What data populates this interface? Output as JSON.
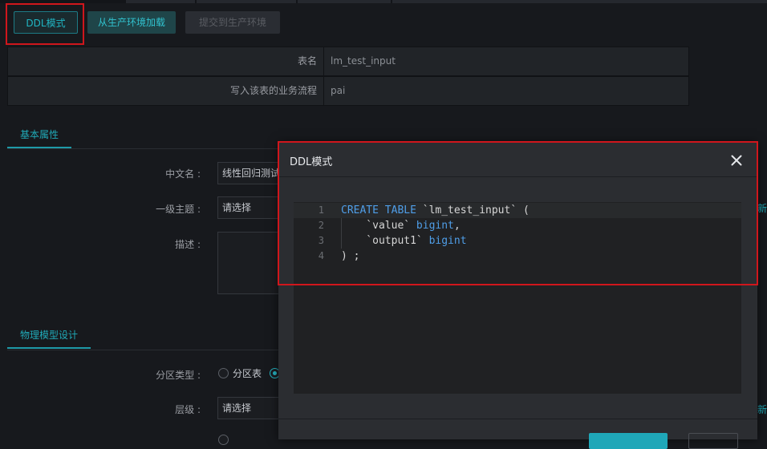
{
  "toolbar": {
    "ddl_mode": "DDL模式",
    "load_from_prod": "从生产环境加载",
    "submit_to_prod": "提交到生产环境"
  },
  "table_info": {
    "rows": [
      {
        "label": "表名",
        "value": "lm_test_input"
      },
      {
        "label": "写入该表的业务流程",
        "value": "pai"
      }
    ]
  },
  "sections": {
    "basic": "基本属性",
    "physical": "物理模型设计"
  },
  "basic_form": {
    "chinese_name_label": "中文名",
    "chinese_name_value": "线性回归测试",
    "level1_topic_label": "一级主题",
    "level1_topic_value": "请选择",
    "description_label": "描述"
  },
  "physical_form": {
    "partition_type_label": "分区类型",
    "partition_table_option": "分区表",
    "level_label": "层级",
    "level_value": "请选择"
  },
  "edge": {
    "new_topic_link": "新建"
  },
  "modal": {
    "title": "DDL模式",
    "close_icon": "close-icon",
    "code_lines": [
      {
        "num": "1",
        "text": "CREATE TABLE `lm_test_input` ("
      },
      {
        "num": "2",
        "text": "    `value` bigint,"
      },
      {
        "num": "3",
        "text": "    `output1` bigint"
      },
      {
        "num": "4",
        "text": ") ;"
      }
    ]
  },
  "colors": {
    "accent": "#20b6c4",
    "highlight_box": "#d0161c",
    "keyword": "#4f9ee8",
    "background": "#17191d",
    "modal_bg": "#2b2d31"
  }
}
